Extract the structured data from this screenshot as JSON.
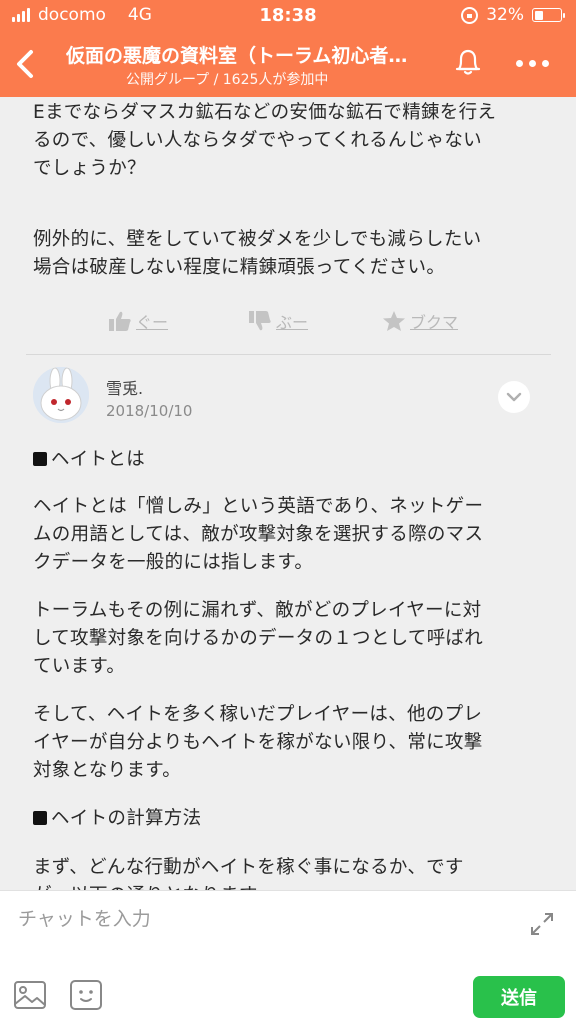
{
  "status_bar": {
    "carrier": "docomo",
    "network": "4G",
    "time": "18:38",
    "battery_percent": "32%",
    "battery_level": 0.32
  },
  "header": {
    "title": "仮面の悪魔の資料室（トーラム初心者…",
    "subtitle": "公開グループ / 1625人が参加中",
    "accent_color": "#fb7b4d",
    "icons": [
      "chevron-left-icon",
      "bell-icon",
      "more-icon"
    ]
  },
  "post_tail": {
    "paragraph_1": [
      "Eまでならダマスカ鉱石などの安価な鉱石で精錬を行え",
      "るので、優しい人ならタダでやってくれるんじゃない",
      "でしょうか？"
    ],
    "paragraph_2": [
      "例外的に、壁をしていて被ダメを少しでも減らしたい",
      "場合は破産しない程度に精錬頑張ってください。"
    ]
  },
  "reactions": {
    "like_label": "ぐー",
    "dislike_label": "ぶー",
    "bookmark_label": "ブクマ"
  },
  "comment": {
    "author": "雪兎.",
    "date": "2018/10/10",
    "heading_1": "ヘイトとは",
    "paragraph_1": [
      "ヘイトとは「憎しみ」という英語であり、ネットゲー",
      "ムの用語としては、敵が攻撃対象を選択する際のマス",
      "クデータを一般的には指します。"
    ],
    "paragraph_2": [
      "トーラムもその例に漏れず、敵がどのプレイヤーに対",
      "して攻撃対象を向けるかのデータの１つとして呼ばれ",
      "ています。"
    ],
    "paragraph_3": [
      "そして、ヘイトを多く稼いだプレイヤーは、他のプレ",
      "イヤーが自分よりもヘイトを稼がない限り、常に攻撃",
      "対象となります。"
    ],
    "heading_2": "ヘイトの計算方法",
    "paragraph_4": [
      "まず、どんな行動がヘイトを稼ぐ事になるか、です",
      "が、以下の通りとなります。"
    ]
  },
  "input": {
    "placeholder": "チャットを入力",
    "send_label": "送信",
    "send_color": "#29c14b"
  }
}
